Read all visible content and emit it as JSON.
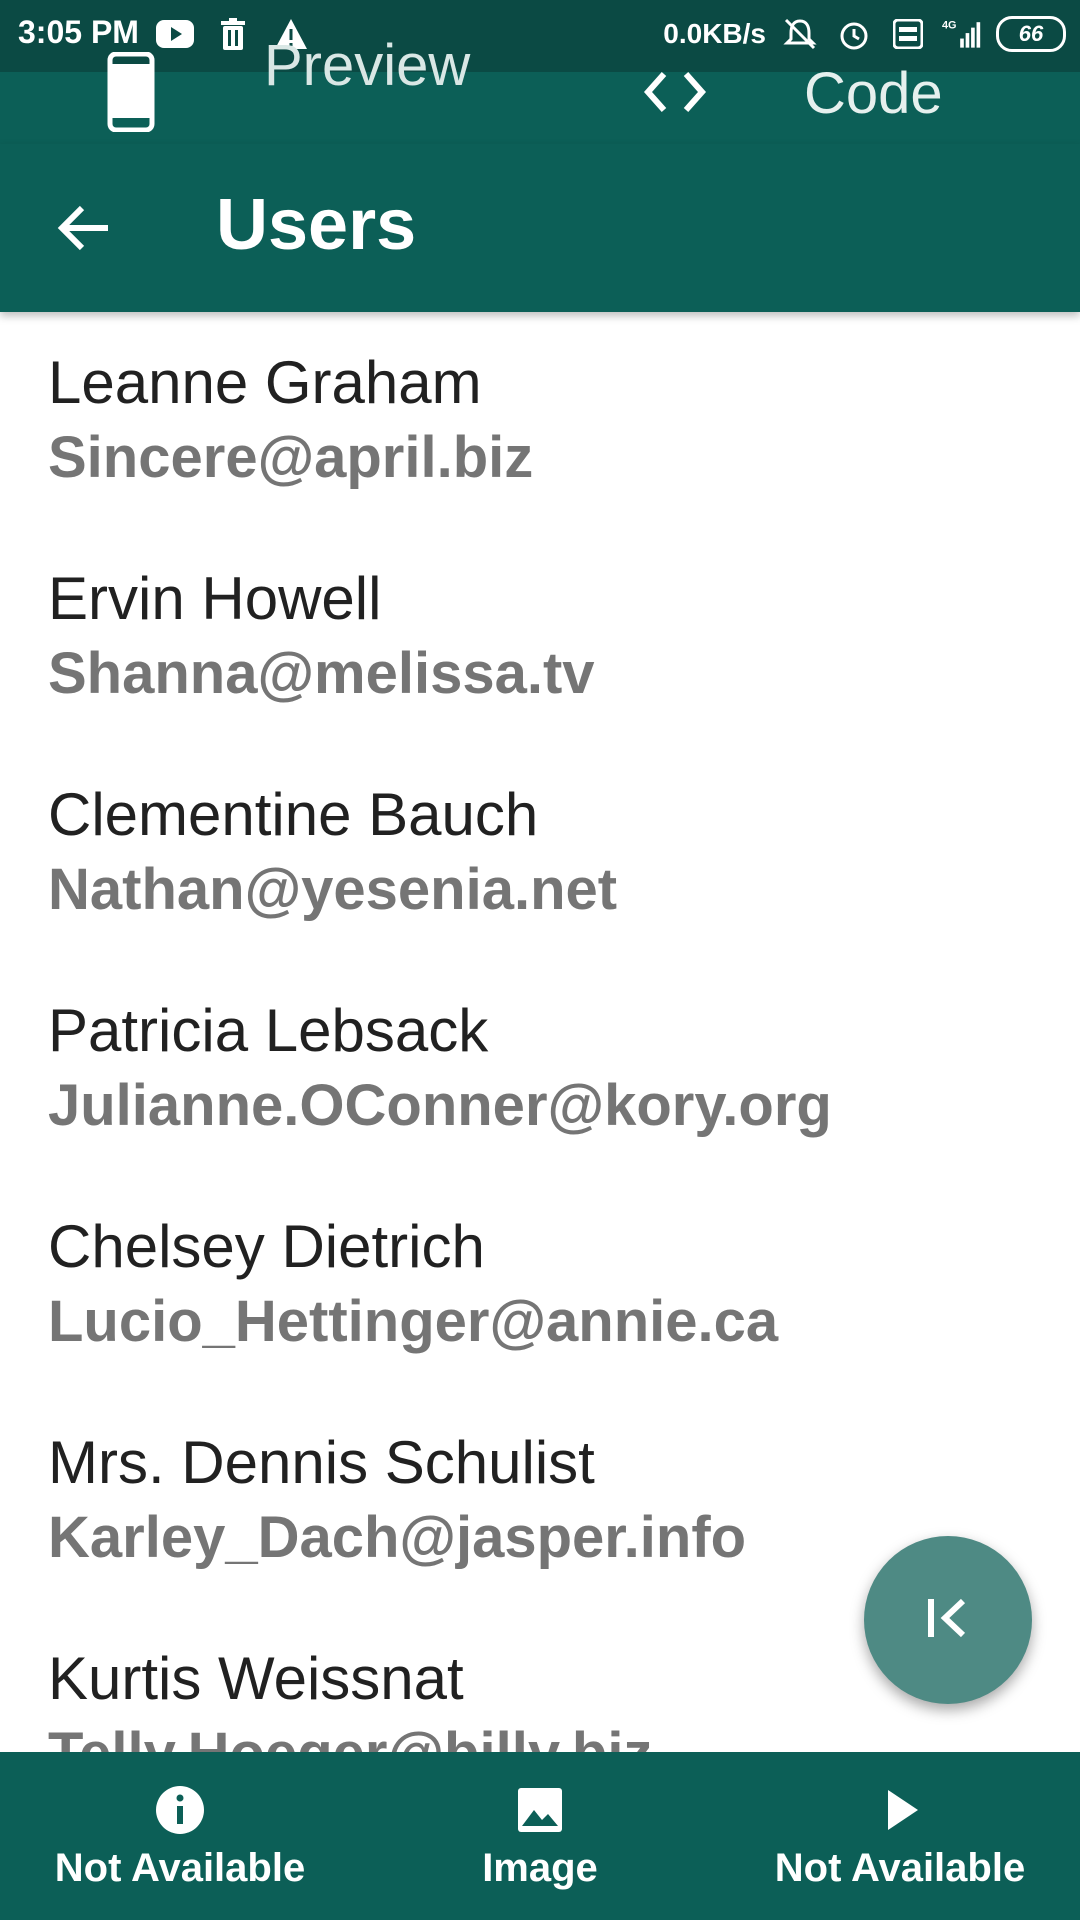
{
  "status_bar": {
    "time": "3:05 PM",
    "net_speed": "0.0KB/s",
    "network": "4G",
    "battery": "66",
    "icons": [
      "youtube-icon",
      "trash-icon",
      "warning-icon",
      "mute-icon",
      "alarm-icon",
      "volte-icon",
      "signal-icon",
      "battery-icon"
    ]
  },
  "mode_bar": {
    "preview_label": "Preview",
    "code_label": "Code"
  },
  "app_bar": {
    "title": "Users"
  },
  "users": [
    {
      "name": "Leanne Graham",
      "email": "Sincere@april.biz"
    },
    {
      "name": "Ervin Howell",
      "email": "Shanna@melissa.tv"
    },
    {
      "name": "Clementine Bauch",
      "email": "Nathan@yesenia.net"
    },
    {
      "name": "Patricia Lebsack",
      "email": "Julianne.OConner@kory.org"
    },
    {
      "name": "Chelsey Dietrich",
      "email": "Lucio_Hettinger@annie.ca"
    },
    {
      "name": "Mrs. Dennis Schulist",
      "email": "Karley_Dach@jasper.info"
    },
    {
      "name": "Kurtis Weissnat",
      "email": "Telly.Hoeger@billy.biz"
    }
  ],
  "bottom_nav": {
    "items": [
      {
        "label": "Not Available",
        "icon": "info-icon"
      },
      {
        "label": "Image",
        "icon": "image-icon"
      },
      {
        "label": "Not Available",
        "icon": "play-icon"
      }
    ]
  },
  "colors": {
    "primary": "#0c5f57",
    "status_bar": "#0b4a44",
    "fab": "#4e8a84",
    "email_text": "#757575"
  }
}
